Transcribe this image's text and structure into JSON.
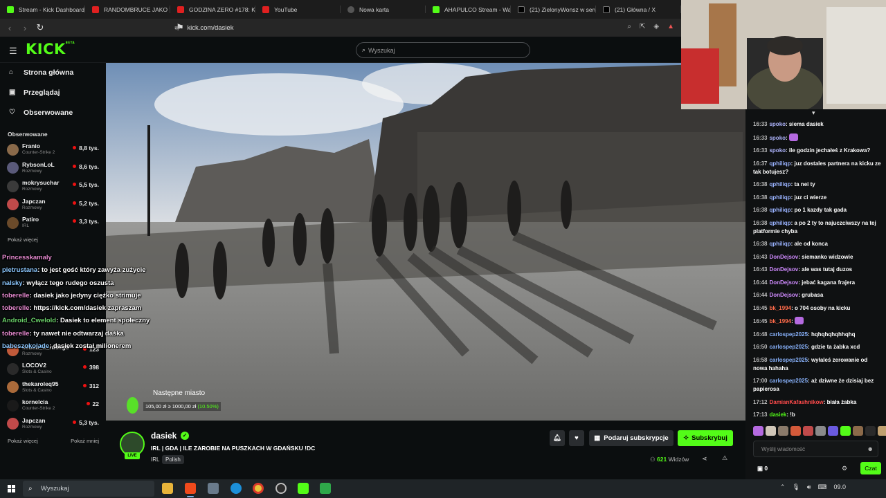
{
  "browser": {
    "tabs": [
      {
        "title": "Stream - Kick Dashboard",
        "icon": "kick"
      },
      {
        "title": "RANDOMBRUCE JAKO \"TO",
        "icon": "youtube"
      },
      {
        "title": "GODZINA ZERO #178: KR",
        "icon": "youtube"
      },
      {
        "title": "YouTube",
        "icon": "youtube"
      },
      {
        "title": "Nowa karta",
        "icon": "shield"
      },
      {
        "title": "AHAPULCO Stream - Watc",
        "icon": "kick"
      },
      {
        "title": "(21) ZielonyWonsz w serw",
        "icon": "x"
      },
      {
        "title": "(21) Główna / X",
        "icon": "x"
      }
    ],
    "url": "kick.com/dasiek"
  },
  "header": {
    "logo": "KICK",
    "logo_badge": "BETA",
    "search_placeholder": "Wyszukaj"
  },
  "sidebar": {
    "nav": [
      {
        "label": "Strona główna",
        "icon": "home-icon",
        "glyph": "⌂"
      },
      {
        "label": "Przeglądaj",
        "icon": "browse-icon",
        "glyph": "▣"
      },
      {
        "label": "Obserwowane",
        "icon": "heart-icon",
        "glyph": "♡"
      }
    ],
    "followed_title": "Obserwowane",
    "followed": [
      {
        "name": "Franio",
        "category": "Counter-Strike 2",
        "viewers": "8,8 tys.",
        "color": "#8a6a4a"
      },
      {
        "name": "RybsonLoL",
        "category": "Rozmowy",
        "viewers": "8,6 tys.",
        "color": "#5a5a7a"
      },
      {
        "name": "mokrysuchar",
        "category": "Rozmowy",
        "viewers": "5,5 tys.",
        "color": "#3a3a3a"
      },
      {
        "name": "Japczan",
        "category": "Rozmowy",
        "viewers": "5,2 tys.",
        "color": "#c04a4a"
      },
      {
        "name": "Patiro",
        "category": "IRL",
        "viewers": "3,3 tys.",
        "color": "#6a4a2a"
      }
    ],
    "show_more": "Pokaż więcej",
    "followed_lower": [
      {
        "name": "kebab_u_rudego",
        "category": "Rozmowy",
        "viewers": "123",
        "color": "#c05a3a"
      },
      {
        "name": "LOCOV2",
        "category": "Slots & Casino",
        "viewers": "398",
        "color": "#2a2a2a"
      },
      {
        "name": "thekaroleq95",
        "category": "Slots & Casino",
        "viewers": "312",
        "color": "#aa6a3a"
      },
      {
        "name": "kornelcia",
        "category": "Counter-Strike 2",
        "viewers": "22",
        "color": "#1a1a1a"
      },
      {
        "name": "Japczan",
        "category": "Rozmowy",
        "viewers": "5,3 tys.",
        "color": "#c04a4a"
      }
    ],
    "show_more_2": "Pokaż więcej",
    "show_less": "Pokaż mniej"
  },
  "overlay_chat": [
    {
      "user": "Princesskamaly",
      "text": "",
      "color": "p"
    },
    {
      "user": "pietrustana",
      "text": "to jest gość który zawyża zużycie",
      "color": ""
    },
    {
      "user": "nalsky",
      "text": "wyłącz tego rudego oszusta",
      "color": ""
    },
    {
      "user": "toberelle",
      "text": "dasiek jako jedyny ciężko strimuje",
      "color": "p"
    },
    {
      "user": "toberelle",
      "text": "https://kick.com/dasiek zapraszam",
      "color": "p"
    },
    {
      "user": "Android_Cwelold",
      "text": "Dasiek to element społeczny",
      "color": "g"
    },
    {
      "user": "toberelle",
      "text": "ty nawet nie odtwarzaj daśka",
      "color": "p"
    },
    {
      "user": "babeszokolade",
      "text": "dasiek został milionerem",
      "color": ""
    }
  ],
  "overlay_goal": {
    "title": "Następne miasto",
    "progress_text": "105,00 zł ≥ 1000,00 zł",
    "percent": "(10.50%)"
  },
  "stream": {
    "name": "dasiek",
    "live": "LIVE",
    "title": "IRL | GDA | ILE ZAROBIE NA PUSZKACH W GDAŃSKU !DC",
    "category": "IRL",
    "language": "Polish",
    "viewers": "621",
    "viewers_label": "Widzów",
    "gift_label": "Podaruj subskrypcje",
    "subscribe_label": "Subskrybuj"
  },
  "chat": {
    "messages": [
      {
        "time": "16:33",
        "user": "spoko",
        "text": "siema dasiek",
        "cls": ""
      },
      {
        "time": "16:33",
        "user": "spoko",
        "text": "",
        "cls": "",
        "emote": true
      },
      {
        "time": "16:33",
        "user": "spoko",
        "text": "ile godzin jechałeś z Krakowa?",
        "cls": ""
      },
      {
        "time": "16:37",
        "user": "qphiliqp",
        "text": "juz dostales partnera na kicku ze tak botujesz?",
        "cls": "q"
      },
      {
        "time": "16:38",
        "user": "qphiliqp",
        "text": "ta nei ty",
        "cls": "q"
      },
      {
        "time": "16:38",
        "user": "qphiliqp",
        "text": "juz ci wierze",
        "cls": "q"
      },
      {
        "time": "16:38",
        "user": "qphiliqp",
        "text": "po 1 kazdy tak gada",
        "cls": "q"
      },
      {
        "time": "16:38",
        "user": "qphiliqp",
        "text": "a po 2 ty to najuczciwszy na tej platformie chyba",
        "cls": "q"
      },
      {
        "time": "16:38",
        "user": "qphiliqp",
        "text": "ale od konca",
        "cls": "q"
      },
      {
        "time": "16:43",
        "user": "DonDejsov",
        "text": "siemanko widzowie",
        "cls": "d"
      },
      {
        "time": "16:43",
        "user": "DonDejsov",
        "text": "ale was tutaj duzos",
        "cls": "d"
      },
      {
        "time": "16:44",
        "user": "DonDejsov",
        "text": "jebać kagana frajera",
        "cls": "d"
      },
      {
        "time": "16:44",
        "user": "DonDejsov",
        "text": "grubasa",
        "cls": "d"
      },
      {
        "time": "16:45",
        "user": "bk_1994",
        "text": "o 704 osoby na kicku",
        "cls": "b"
      },
      {
        "time": "16:45",
        "user": "bk_1994",
        "text": "",
        "cls": "b",
        "emote": true
      },
      {
        "time": "16:48",
        "user": "carlospep2025",
        "text": "hqhqhqhqhhqhq",
        "cls": "c"
      },
      {
        "time": "16:50",
        "user": "carlospep2025",
        "text": "gdzie ta żabka xcd",
        "cls": "c"
      },
      {
        "time": "16:58",
        "user": "carlospep2025",
        "text": "wyłaleś zerowanie od nowa hahaha",
        "cls": "c"
      },
      {
        "time": "17:00",
        "user": "carlospep2025",
        "text": "aż dziwne że dzisiaj bez papierosa",
        "cls": "c"
      },
      {
        "time": "17:12",
        "user": "DamianKafashnikow",
        "text": "biała żabka",
        "cls": "r"
      },
      {
        "time": "17:13",
        "user": "dasiek",
        "text": "!b",
        "cls": "k"
      }
    ],
    "input_placeholder": "Wyślij wiadomość",
    "points": "0",
    "send_label": "Czat"
  },
  "taskbar": {
    "search_placeholder": "Wyszukaj",
    "clock": "09.0"
  }
}
